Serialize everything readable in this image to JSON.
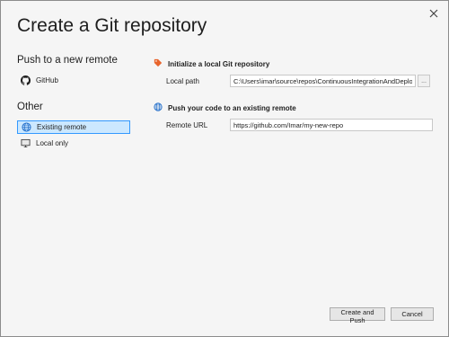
{
  "window": {
    "title": "Create a Git repository",
    "close_icon": "close-icon"
  },
  "sidebar": {
    "push_section": "Push to a new remote",
    "push_items": [
      {
        "label": "GitHub",
        "icon": "github-icon"
      }
    ],
    "other_section": "Other",
    "other_items": [
      {
        "label": "Existing remote",
        "icon": "globe-icon",
        "selected": true
      },
      {
        "label": "Local only",
        "icon": "computer-icon",
        "selected": false
      }
    ]
  },
  "init": {
    "heading": "Initialize a local Git repository",
    "local_path_label": "Local path",
    "local_path_value": "C:\\Users\\imar\\source\\repos\\ContinuousIntegrationAndDeplo",
    "browse_label": "..."
  },
  "push": {
    "heading": "Push your code to an existing remote",
    "remote_url_label": "Remote URL",
    "remote_url_value": "https://github.com/Imar/my-new-repo"
  },
  "footer": {
    "create_push_label": "Create and Push",
    "cancel_label": "Cancel"
  },
  "colors": {
    "accent": "#3399ff",
    "selected_bg": "#cce8ff",
    "tag_orange": "#e8642c"
  }
}
